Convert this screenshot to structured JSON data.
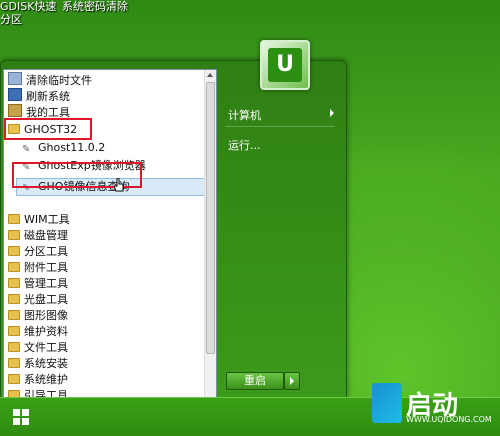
{
  "desktop": {
    "icons": [
      {
        "label": "GDISK快速分区"
      },
      {
        "label": "系统密码清除"
      }
    ]
  },
  "start_menu": {
    "left_items": [
      {
        "label": "清除临时文件",
        "icon": "cleanup-icon"
      },
      {
        "label": "刷新系统",
        "icon": "refresh-icon"
      },
      {
        "label": "我的工具",
        "icon": "tools-icon"
      },
      {
        "label": "GHOST32",
        "icon": "folder-icon"
      },
      {
        "label": "Ghost11.0.2",
        "icon": "ghost-icon"
      },
      {
        "label": "GhostExp镜像浏览器",
        "icon": "ghost-icon"
      },
      {
        "label": "GHO镜像信息查询",
        "icon": "ghost-icon"
      },
      {
        "label": "WIM工具",
        "icon": "folder-icon"
      },
      {
        "label": "磁盘管理",
        "icon": "folder-icon"
      },
      {
        "label": "分区工具",
        "icon": "folder-icon"
      },
      {
        "label": "附件工具",
        "icon": "folder-icon"
      },
      {
        "label": "管理工具",
        "icon": "folder-icon"
      },
      {
        "label": "光盘工具",
        "icon": "folder-icon"
      },
      {
        "label": "图形图像",
        "icon": "folder-icon"
      },
      {
        "label": "维护资料",
        "icon": "folder-icon"
      },
      {
        "label": "文件工具",
        "icon": "folder-icon"
      },
      {
        "label": "系统安装",
        "icon": "folder-icon"
      },
      {
        "label": "系统维护",
        "icon": "folder-icon"
      },
      {
        "label": "引导工具",
        "icon": "folder-icon"
      }
    ],
    "right_items": [
      {
        "label": "计算机"
      },
      {
        "label": "运行..."
      }
    ],
    "shutdown_label": "重启"
  },
  "brand": {
    "text": "启动",
    "url": "WWW.UQIDONG.COM"
  },
  "colors": {
    "accent": "#3c9a1a",
    "highlight_border": "#e0142a"
  }
}
